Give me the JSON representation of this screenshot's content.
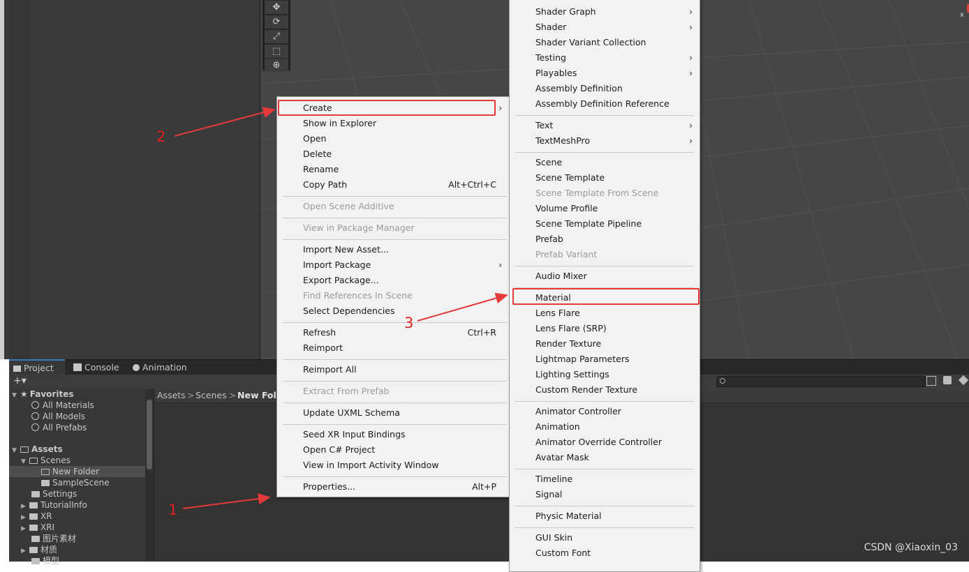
{
  "tools": [
    "✥",
    "⟳",
    "⤢",
    "⬚",
    "⊕"
  ],
  "project_tabs": [
    {
      "label": "Project",
      "icon": "folder-icon",
      "active": true
    },
    {
      "label": "Console",
      "icon": "console-icon",
      "active": false
    },
    {
      "label": "Animation",
      "icon": "clock-icon",
      "active": false
    }
  ],
  "toolbar": {
    "add_label": "+▾"
  },
  "tree": {
    "favorites": "Favorites",
    "favorite_items": [
      "All Materials",
      "All Models",
      "All Prefabs"
    ],
    "assets": "Assets",
    "scenes": "Scenes",
    "new_folder": "New Folder",
    "sample_scene": "SampleScene",
    "settings": "Settings",
    "tutorialinfo": "TutorialInfo",
    "xr": "XR",
    "xri": "XRI",
    "images": "图片素材",
    "materials": "材质",
    "models": "模型"
  },
  "breadcrumb": {
    "assets": "Assets",
    "sep": ">",
    "scenes": "Scenes",
    "current": "New Folde"
  },
  "context_menu": {
    "items": [
      {
        "label": "Create",
        "arrow": true
      },
      {
        "label": "Show in Explorer"
      },
      {
        "label": "Open"
      },
      {
        "label": "Delete"
      },
      {
        "label": "Rename"
      },
      {
        "label": "Copy Path",
        "shortcut": "Alt+Ctrl+C"
      },
      {
        "label": "Open Scene Additive",
        "disabled": true
      },
      {
        "label": "View in Package Manager",
        "disabled": true
      },
      {
        "label": "Import New Asset..."
      },
      {
        "label": "Import Package",
        "arrow": true
      },
      {
        "label": "Export Package..."
      },
      {
        "label": "Find References In Scene",
        "disabled": true
      },
      {
        "label": "Select Dependencies"
      },
      {
        "label": "Refresh",
        "shortcut": "Ctrl+R"
      },
      {
        "label": "Reimport"
      },
      {
        "label": "Reimport All"
      },
      {
        "label": "Extract From Prefab",
        "disabled": true
      },
      {
        "label": "Update UXML Schema"
      },
      {
        "label": "Seed XR Input Bindings"
      },
      {
        "label": "Open C# Project"
      },
      {
        "label": "View in Import Activity Window"
      },
      {
        "label": "Properties...",
        "shortcut": "Alt+P"
      }
    ],
    "arrow_glyph": "›"
  },
  "create_menu": {
    "items": [
      {
        "label": "Shader Graph",
        "arrow": true
      },
      {
        "label": "Shader",
        "arrow": true
      },
      {
        "label": "Shader Variant Collection"
      },
      {
        "label": "Testing",
        "arrow": true
      },
      {
        "label": "Playables",
        "arrow": true
      },
      {
        "label": "Assembly Definition"
      },
      {
        "label": "Assembly Definition Reference"
      },
      {
        "label": "Text",
        "arrow": true
      },
      {
        "label": "TextMeshPro",
        "arrow": true
      },
      {
        "label": "Scene"
      },
      {
        "label": "Scene Template"
      },
      {
        "label": "Scene Template From Scene",
        "disabled": true
      },
      {
        "label": "Volume Profile"
      },
      {
        "label": "Scene Template Pipeline"
      },
      {
        "label": "Prefab"
      },
      {
        "label": "Prefab Variant",
        "disabled": true
      },
      {
        "label": "Audio Mixer"
      },
      {
        "label": "Material"
      },
      {
        "label": "Lens Flare"
      },
      {
        "label": "Lens Flare (SRP)"
      },
      {
        "label": "Render Texture"
      },
      {
        "label": "Lightmap Parameters"
      },
      {
        "label": "Lighting Settings"
      },
      {
        "label": "Custom Render Texture"
      },
      {
        "label": "Animator Controller"
      },
      {
        "label": "Animation"
      },
      {
        "label": "Animator Override Controller"
      },
      {
        "label": "Avatar Mask"
      },
      {
        "label": "Timeline"
      },
      {
        "label": "Signal"
      },
      {
        "label": "Physic Material"
      },
      {
        "label": "GUI Skin"
      },
      {
        "label": "Custom Font"
      }
    ]
  },
  "annotations": {
    "step1": "1",
    "step2": "2",
    "step3": "3",
    "color": "#e02020"
  },
  "watermark": "CSDN @Xiaoxin_03",
  "corner_x": "x"
}
